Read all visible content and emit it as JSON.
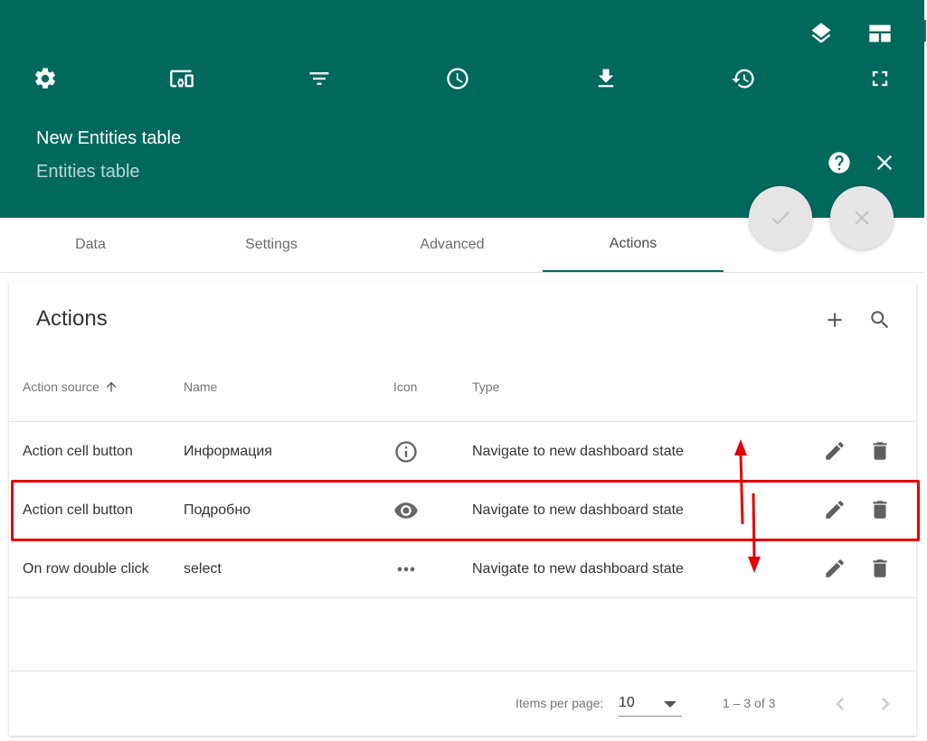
{
  "header": {
    "title": "New Entities table",
    "subtitle": "Entities table",
    "toolbar_icons": [
      "gear-icon",
      "devices-icon",
      "filter-icon",
      "clock-icon",
      "download-icon",
      "history-icon",
      "fullscreen-icon"
    ],
    "top_icons": [
      "layers-icon",
      "layout-icon"
    ],
    "right_icons": [
      "help-icon",
      "close-icon"
    ],
    "fab_buttons": [
      "apply-check-icon",
      "cancel-close-icon"
    ],
    "color": "#00695c"
  },
  "tabs": [
    {
      "label": "Data"
    },
    {
      "label": "Settings"
    },
    {
      "label": "Advanced"
    },
    {
      "label": "Actions",
      "active": true
    }
  ],
  "actions": {
    "title": "Actions",
    "columns": [
      "Action source",
      "Name",
      "Icon",
      "Type"
    ],
    "sort_column": "Action source",
    "rows": [
      {
        "source": "Action cell button",
        "name": "Информация",
        "icon": "info-icon",
        "type": "Navigate to new dashboard state"
      },
      {
        "source": "Action cell button",
        "name": "Подробно",
        "icon": "eye-icon",
        "type": "Navigate to new dashboard state"
      },
      {
        "source": "On row double click",
        "name": "select",
        "icon": "more-horiz-icon",
        "type": "Navigate to new dashboard state"
      }
    ]
  },
  "pagination": {
    "items_per_page_label": "Items per page:",
    "items_per_page": "10",
    "range": "1 – 3 of 3"
  },
  "annotation_color": "#e60000"
}
